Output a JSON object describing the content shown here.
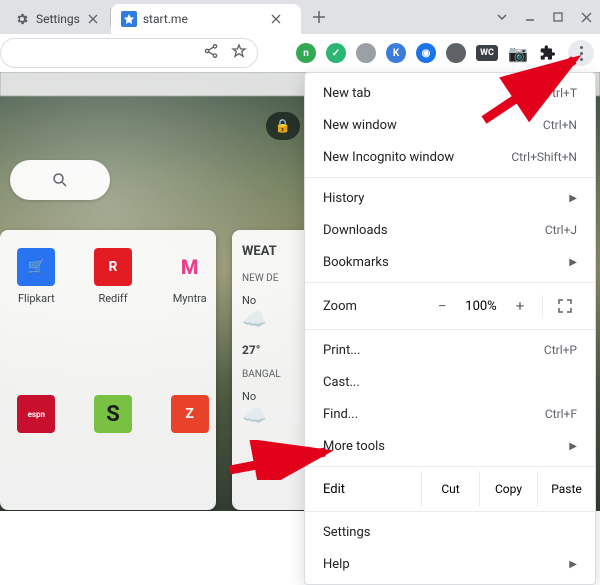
{
  "tabs": {
    "t0": {
      "title": "Settings"
    },
    "t1": {
      "title": "start.me"
    }
  },
  "toolbar": {
    "ext_wc": "WC"
  },
  "page": {
    "links": {
      "l0": {
        "glyph": "🛒",
        "label": "Flipkart"
      },
      "l1": {
        "glyph": "R",
        "label": "Rediff"
      },
      "l2": {
        "glyph": "M",
        "label": "Myntra"
      },
      "l3": {
        "glyph": "espn",
        "label": ""
      },
      "l4": {
        "glyph": "S",
        "label": ""
      },
      "l5": {
        "glyph": "Z",
        "label": ""
      }
    },
    "weather": {
      "title": "WEAT",
      "city1": "NEW DE",
      "abbr1": "No",
      "temp1": "27°",
      "city2": "BANGAL",
      "abbr2": "No"
    }
  },
  "menu": {
    "new_tab": "New tab",
    "sc_new_tab": "trl+T",
    "new_win": "New window",
    "sc_new_win": "Ctrl+N",
    "incog": "New Incognito window",
    "sc_incog": "Ctrl+Shift+N",
    "history": "History",
    "downloads": "Downloads",
    "sc_downloads": "Ctrl+J",
    "bookmarks": "Bookmarks",
    "zoom": "Zoom",
    "zval": "100%",
    "print": "Print...",
    "sc_print": "Ctrl+P",
    "cast": "Cast...",
    "find": "Find...",
    "sc_find": "Ctrl+F",
    "more": "More tools",
    "edit": "Edit",
    "cut": "Cut",
    "copy": "Copy",
    "paste": "Paste",
    "settings": "Settings",
    "help": "Help"
  }
}
